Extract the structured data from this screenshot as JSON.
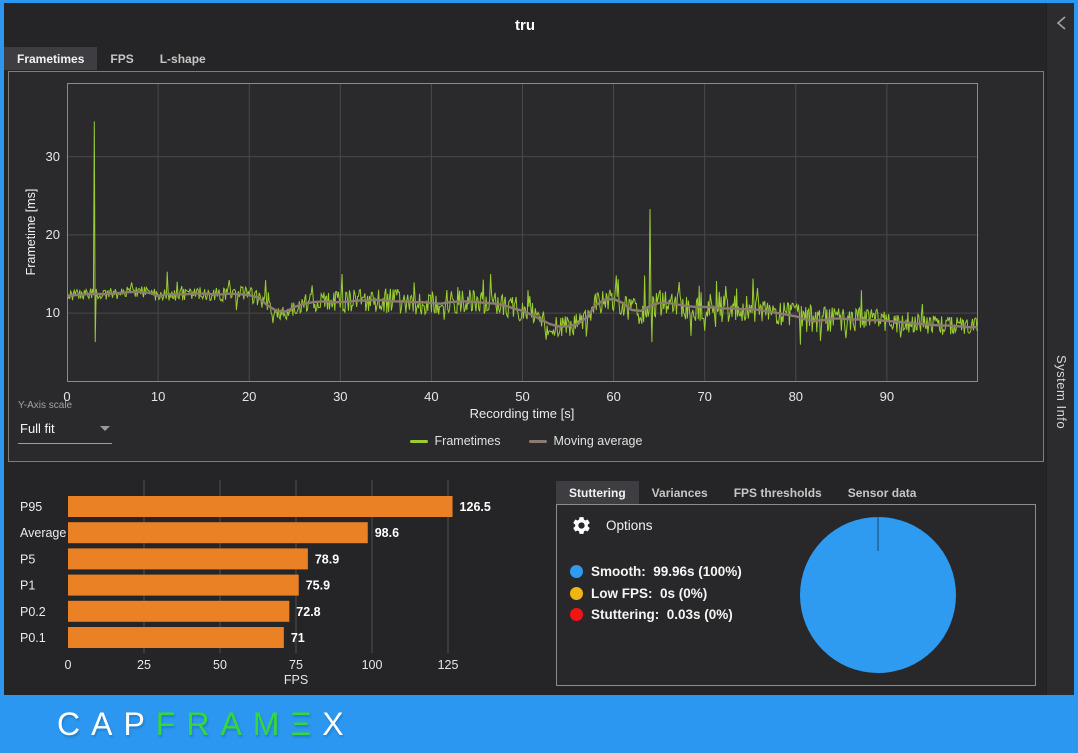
{
  "window": {
    "title": "tru",
    "side_panel": {
      "label": "System Info",
      "collapse_icon": "chevron-left"
    }
  },
  "top_tabs": [
    {
      "label": "Frametimes",
      "selected": true
    },
    {
      "label": "FPS",
      "selected": false
    },
    {
      "label": "L-shape",
      "selected": false
    }
  ],
  "y_axis_scale": {
    "label": "Y-Axis scale",
    "value": "Full fit"
  },
  "analysis_tabs": [
    {
      "label": "Stuttering",
      "selected": true
    },
    {
      "label": "Variances",
      "selected": false
    },
    {
      "label": "FPS thresholds",
      "selected": false
    },
    {
      "label": "Sensor data",
      "selected": false
    }
  ],
  "options_label": "Options",
  "logo_segments": [
    {
      "text": "CAP",
      "color": "#ffffff"
    },
    {
      "text": "FRAM",
      "color": "#35d83a"
    },
    {
      "text": "Ξ",
      "color": "#35d83a"
    },
    {
      "text": "X",
      "color": "#ffffff"
    }
  ],
  "colors": {
    "window_bg": "#252527",
    "panel_bg": "#2a2a2c",
    "grid": "#494949",
    "plot_border": "#8a8a8a",
    "frametimes_green": "#9acd32",
    "moving_average_brown": "#8d7b70",
    "bar_orange": "#ea8125",
    "smooth_blue": "#2e9af0",
    "low_fps_amber": "#f0b415",
    "stutter_red": "#f01414",
    "footer_blue": "#2b97f0"
  },
  "chart_data": [
    {
      "id": "frametimes_line",
      "type": "line",
      "xlabel": "Recording time [s]",
      "ylabel": "Frametime [ms]",
      "xlim": [
        0,
        100
      ],
      "ylim": [
        1.2,
        39.4
      ],
      "x_ticks": [
        0,
        10,
        20,
        30,
        40,
        50,
        60,
        70,
        80,
        90
      ],
      "y_ticks": [
        10,
        20,
        30
      ],
      "grid": true,
      "legend_position": "bottom",
      "series": [
        {
          "name": "Frametimes",
          "color": "#9acd32",
          "style": "noisy"
        },
        {
          "name": "Moving average",
          "color": "#8d7b70",
          "style": "smooth"
        }
      ],
      "moving_average": {
        "x_step": 1,
        "values": [
          12.2,
          12.3,
          12.4,
          12.5,
          12.4,
          12.5,
          12.6,
          12.7,
          12.7,
          12.6,
          12.2,
          12.4,
          12.4,
          12.4,
          12.5,
          12.5,
          12.4,
          12.4,
          12.5,
          12.4,
          12.3,
          12.0,
          11.0,
          10.3,
          10.2,
          10.8,
          11.2,
          11.4,
          11.5,
          11.4,
          11.4,
          11.5,
          11.6,
          11.6,
          11.7,
          11.6,
          11.5,
          11.5,
          11.4,
          11.4,
          11.3,
          11.2,
          11.4,
          11.5,
          11.5,
          11.4,
          11.3,
          11.2,
          11.0,
          10.6,
          10.3,
          9.8,
          9.2,
          8.6,
          8.3,
          8.3,
          8.6,
          9.4,
          11.0,
          11.7,
          11.8,
          11.3,
          10.4,
          10.3,
          10.9,
          11.3,
          11.3,
          11.1,
          10.9,
          10.8,
          10.8,
          10.7,
          10.6,
          10.6,
          10.5,
          10.5,
          10.4,
          10.2,
          10.0,
          9.8,
          9.6,
          9.2,
          9.0,
          9.1,
          9.3,
          9.3,
          9.2,
          9.2,
          9.1,
          9.1,
          9.0,
          8.9,
          8.8,
          8.7,
          8.6,
          8.5,
          8.4,
          8.4,
          8.3,
          8.2,
          8.2
        ]
      },
      "noise_amplitude": {
        "x_step": 5,
        "values": [
          0.7,
          0.75,
          0.8,
          0.8,
          1.0,
          1.1,
          1.4,
          1.6,
          1.6,
          1.5,
          1.4,
          1.3,
          1.6,
          1.8,
          1.8,
          1.7,
          1.6,
          1.7,
          1.4,
          1.3,
          1.2
        ]
      },
      "spikes": [
        {
          "t": 3.0,
          "value": 34.5
        },
        {
          "t": 3.15,
          "value": 6.3
        },
        {
          "t": 11.0,
          "value": 15.3
        },
        {
          "t": 21.8,
          "value": 14.2
        },
        {
          "t": 30.2,
          "value": 15.0
        },
        {
          "t": 46.5,
          "value": 15.0
        },
        {
          "t": 52.6,
          "value": 6.6
        },
        {
          "t": 57.0,
          "value": 7.0
        },
        {
          "t": 63.4,
          "value": 14.8
        },
        {
          "t": 64.0,
          "value": 23.3
        },
        {
          "t": 64.15,
          "value": 6.3
        },
        {
          "t": 68.5,
          "value": 7.1
        },
        {
          "t": 75.3,
          "value": 14.4
        },
        {
          "t": 85.5,
          "value": 6.8
        },
        {
          "t": 91.5,
          "value": 6.9
        }
      ]
    },
    {
      "id": "fps_percentiles_bar",
      "type": "bar",
      "orientation": "horizontal",
      "categories": [
        "P95",
        "Average",
        "P5",
        "P1",
        "P0.2",
        "P0.1"
      ],
      "values": [
        126.5,
        98.6,
        78.9,
        75.9,
        72.8,
        71
      ],
      "value_labels": [
        "126.5",
        "98.6",
        "78.9",
        "75.9",
        "72.8",
        "71"
      ],
      "xlabel": "FPS",
      "x_ticks": [
        0,
        25,
        50,
        75,
        100,
        125
      ],
      "xlim": [
        0,
        150
      ],
      "bar_color": "#ea8125",
      "grid": true
    },
    {
      "id": "stuttering_pie",
      "type": "pie",
      "slices": [
        {
          "label": "Smooth",
          "value_text": "99.96s (100%)",
          "seconds": 99.96,
          "percent": 100,
          "color": "#2e9af0"
        },
        {
          "label": "Low FPS",
          "value_text": "0s (0%)",
          "seconds": 0,
          "percent": 0,
          "color": "#f0b415"
        },
        {
          "label": "Stuttering",
          "value_text": "0.03s (0%)",
          "seconds": 0.03,
          "percent": 0,
          "color": "#f01414"
        }
      ]
    }
  ]
}
